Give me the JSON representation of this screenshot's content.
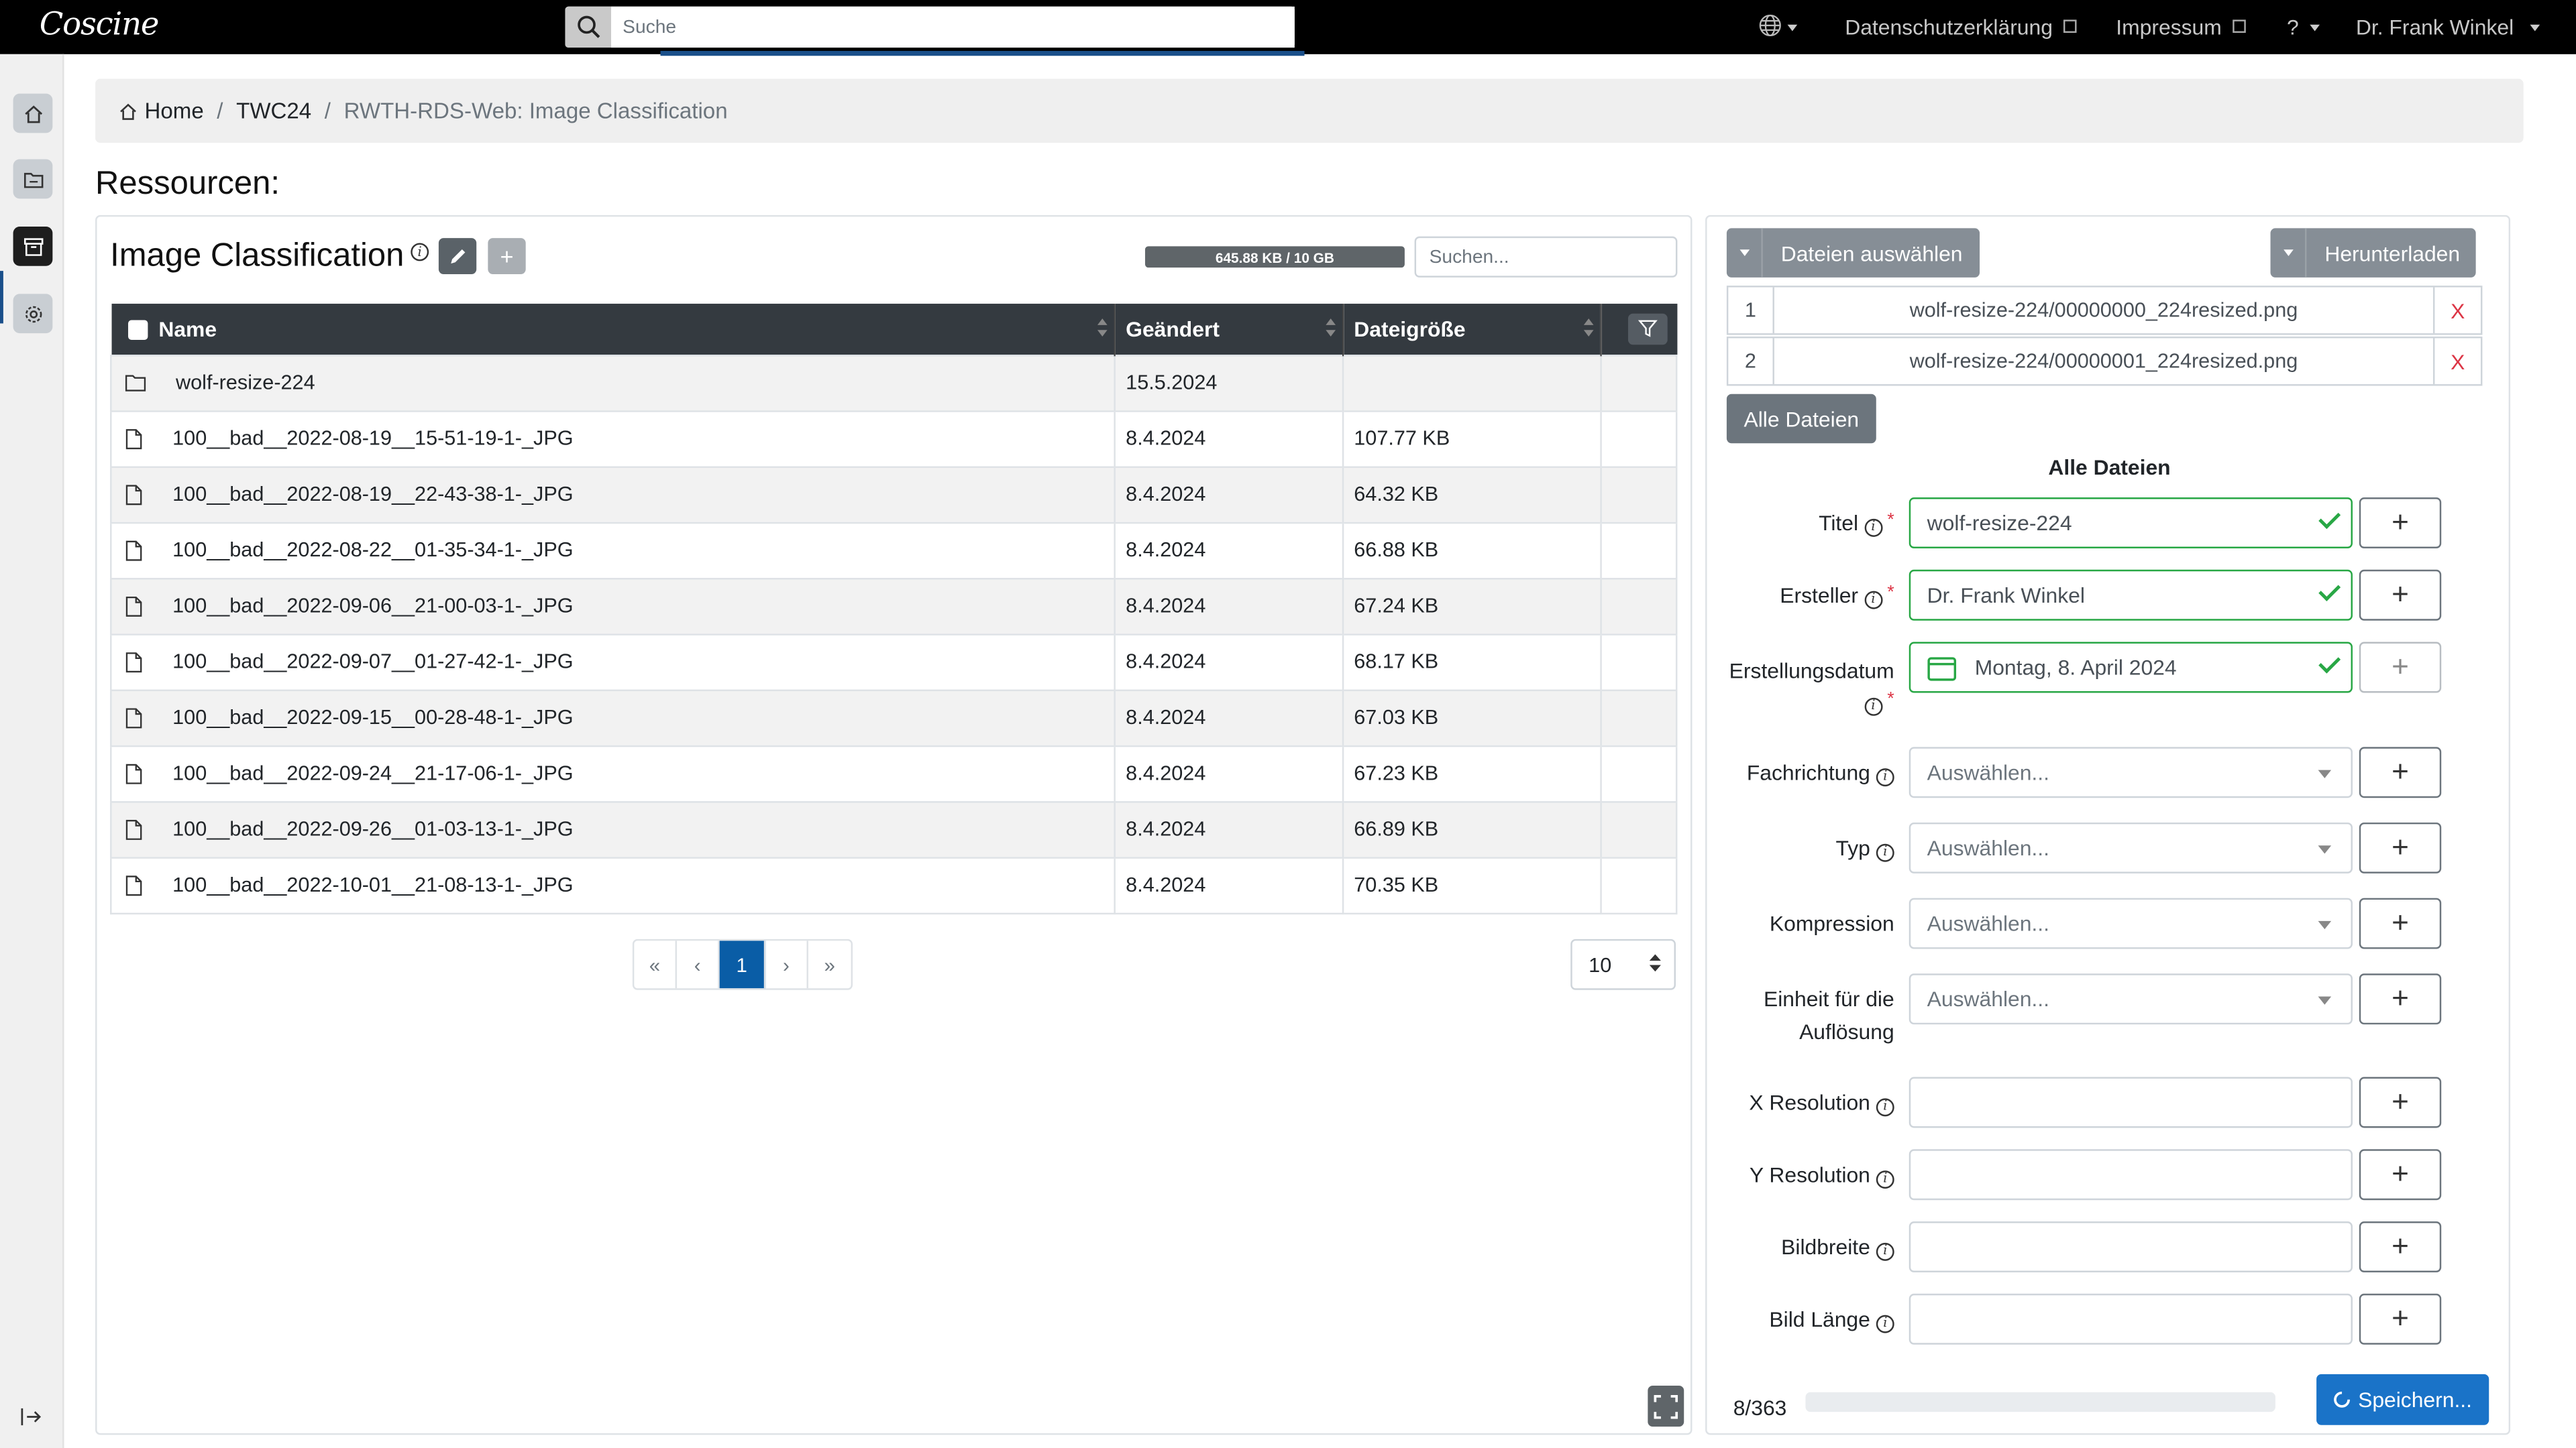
{
  "app": {
    "logo": "Coscine"
  },
  "search": {
    "placeholder": "Suche"
  },
  "topnav": {
    "privacy": "Datenschutzerklärung",
    "imprint": "Impressum",
    "help": "?",
    "user": "Dr. Frank Winkel"
  },
  "breadcrumb": {
    "home": "Home",
    "project": "TWC24",
    "current": "RWTH-RDS-Web: Image Classification"
  },
  "page_title": "Ressourcen:",
  "resource": {
    "title": "Image Classification",
    "quota": "645.88 KB / 10 GB",
    "filter_placeholder": "Suchen..."
  },
  "table": {
    "headers": {
      "name": "Name",
      "changed": "Geändert",
      "size": "Dateigröße"
    },
    "rows": [
      {
        "type": "folder",
        "name": "wolf-resize-224",
        "changed": "15.5.2024",
        "size": ""
      },
      {
        "type": "file",
        "name": "100__bad__2022-08-19__15-51-19-1-_JPG",
        "changed": "8.4.2024",
        "size": "107.77 KB"
      },
      {
        "type": "file",
        "name": "100__bad__2022-08-19__22-43-38-1-_JPG",
        "changed": "8.4.2024",
        "size": "64.32 KB"
      },
      {
        "type": "file",
        "name": "100__bad__2022-08-22__01-35-34-1-_JPG",
        "changed": "8.4.2024",
        "size": "66.88 KB"
      },
      {
        "type": "file",
        "name": "100__bad__2022-09-06__21-00-03-1-_JPG",
        "changed": "8.4.2024",
        "size": "67.24 KB"
      },
      {
        "type": "file",
        "name": "100__bad__2022-09-07__01-27-42-1-_JPG",
        "changed": "8.4.2024",
        "size": "68.17 KB"
      },
      {
        "type": "file",
        "name": "100__bad__2022-09-15__00-28-48-1-_JPG",
        "changed": "8.4.2024",
        "size": "67.03 KB"
      },
      {
        "type": "file",
        "name": "100__bad__2022-09-24__21-17-06-1-_JPG",
        "changed": "8.4.2024",
        "size": "67.23 KB"
      },
      {
        "type": "file",
        "name": "100__bad__2022-09-26__01-03-13-1-_JPG",
        "changed": "8.4.2024",
        "size": "66.89 KB"
      },
      {
        "type": "file",
        "name": "100__bad__2022-10-01__21-08-13-1-_JPG",
        "changed": "8.4.2024",
        "size": "70.35 KB"
      }
    ]
  },
  "pagination": {
    "first": "«",
    "prev": "‹",
    "current": "1",
    "next": "›",
    "last": "»",
    "per_page": "10"
  },
  "upload": {
    "select_files": "Dateien auswählen",
    "download": "Herunterladen",
    "files": [
      {
        "num": "1",
        "path": "wolf-resize-224/00000000_224resized.png",
        "remove": "X"
      },
      {
        "num": "2",
        "path": "wolf-resize-224/00000001_224resized.png",
        "remove": "X"
      }
    ],
    "all_files_button": "Alle Dateien",
    "all_files_heading": "Alle Dateien"
  },
  "form": {
    "title_label": "Titel",
    "title_value": "wolf-resize-224",
    "creator_label": "Ersteller",
    "creator_value": "Dr. Frank Winkel",
    "date_label": "Erstellungsdatum",
    "date_value": "Montag, 8. April 2024",
    "field_label": "Fachrichtung",
    "type_label": "Typ",
    "compression_label": "Kompression",
    "unit_label": "Einheit für die Auflösung",
    "select_placeholder": "Auswählen...",
    "xres_label": "X Resolution",
    "yres_label": "Y Resolution",
    "width_label": "Bildbreite",
    "length_label": "Bild Länge",
    "plus": "+"
  },
  "footer": {
    "counter": "8/363",
    "progress": 0,
    "save": "Speichern..."
  },
  "colors": {
    "accent": "#1a73c8",
    "valid": "#28a745",
    "danger": "#dc3545",
    "header": "#343a40"
  }
}
